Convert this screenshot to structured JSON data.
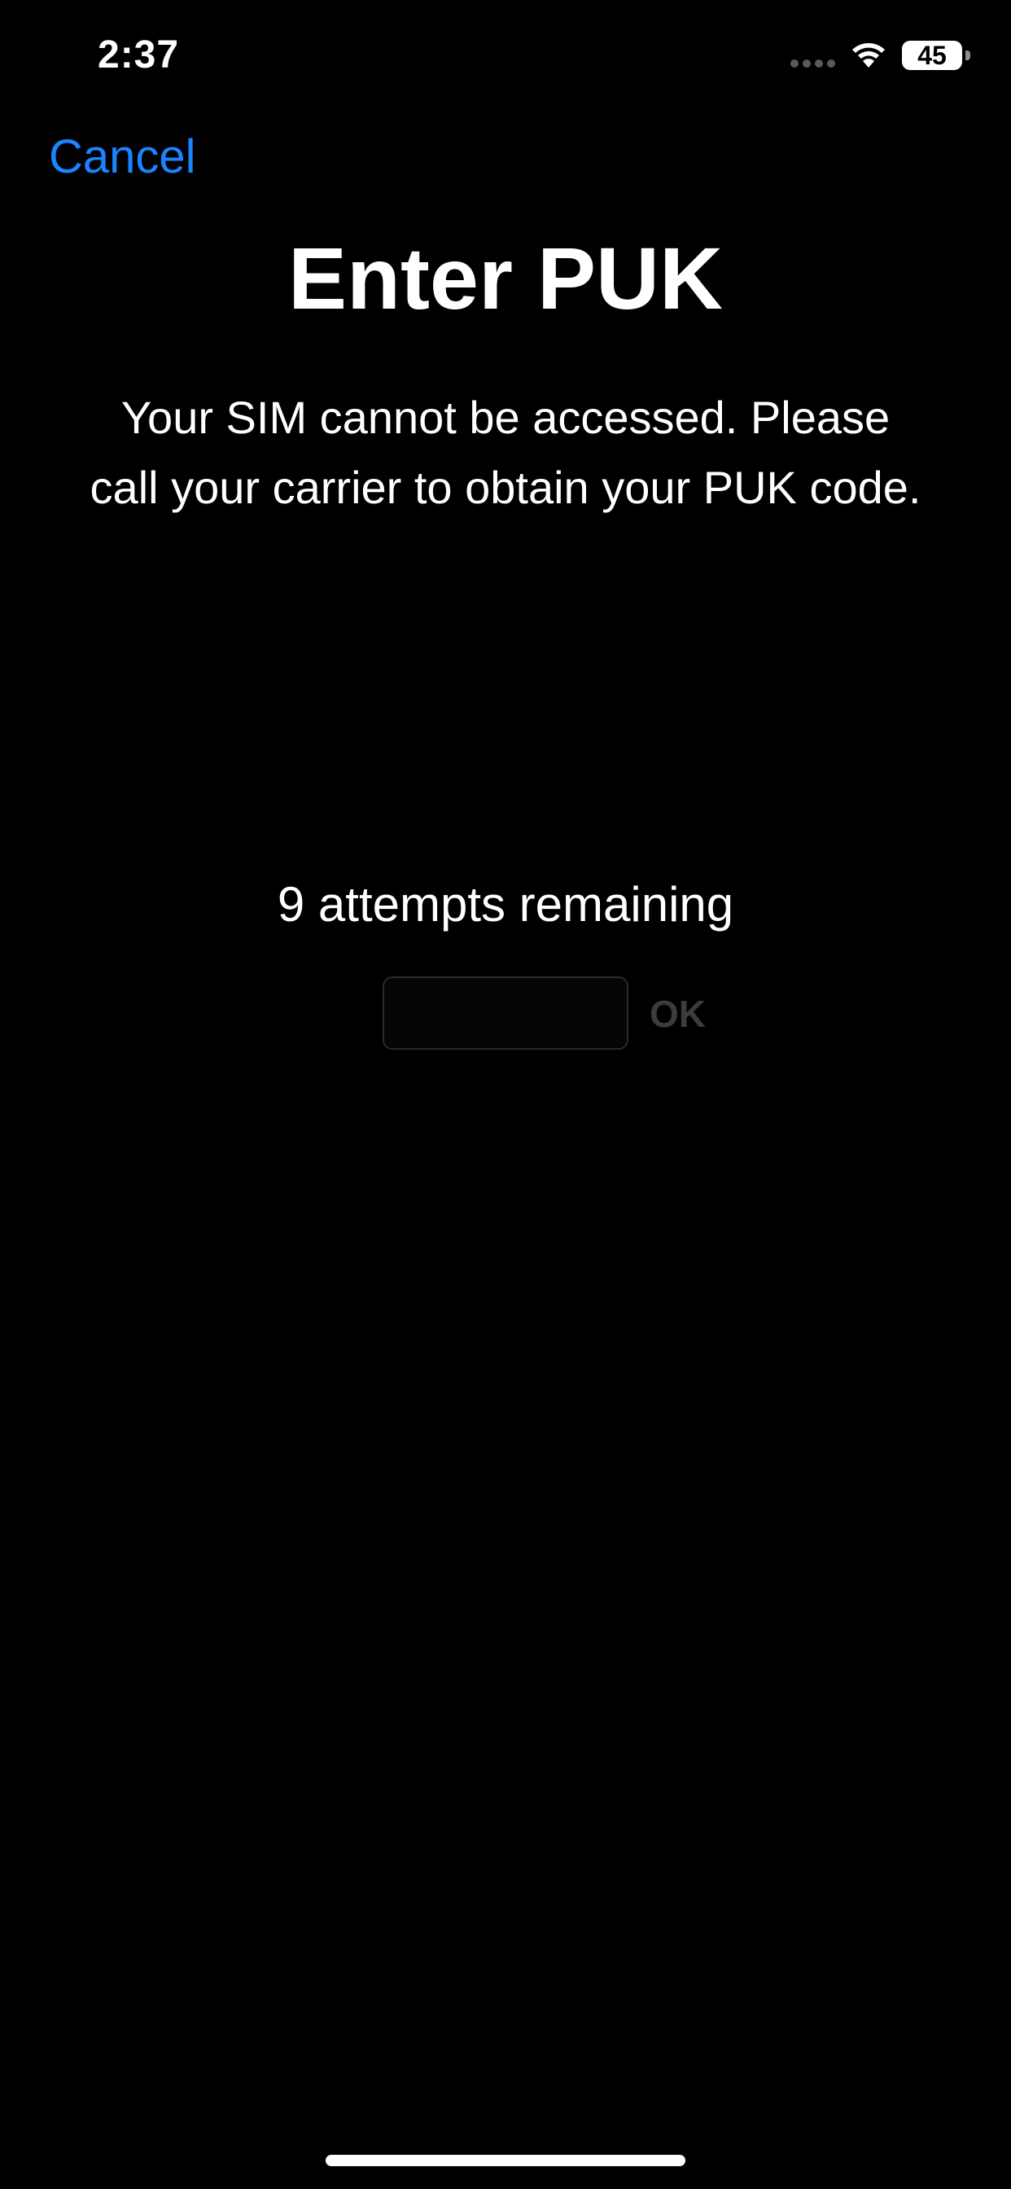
{
  "status_bar": {
    "time": "2:37",
    "battery_level": "45",
    "icons": [
      "signal-dots-icon",
      "wifi-icon",
      "battery-icon"
    ]
  },
  "nav": {
    "cancel_label": "Cancel"
  },
  "main": {
    "title": "Enter PUK",
    "message": "Your SIM cannot be accessed. Please call your carrier to obtain your PUK code.",
    "attempts": "9 attempts remaining",
    "puk_input_value": "",
    "ok_label": "OK"
  },
  "colors": {
    "background": "#000000",
    "accent": "#1a84ff",
    "disabled": "#3c3c3c"
  }
}
